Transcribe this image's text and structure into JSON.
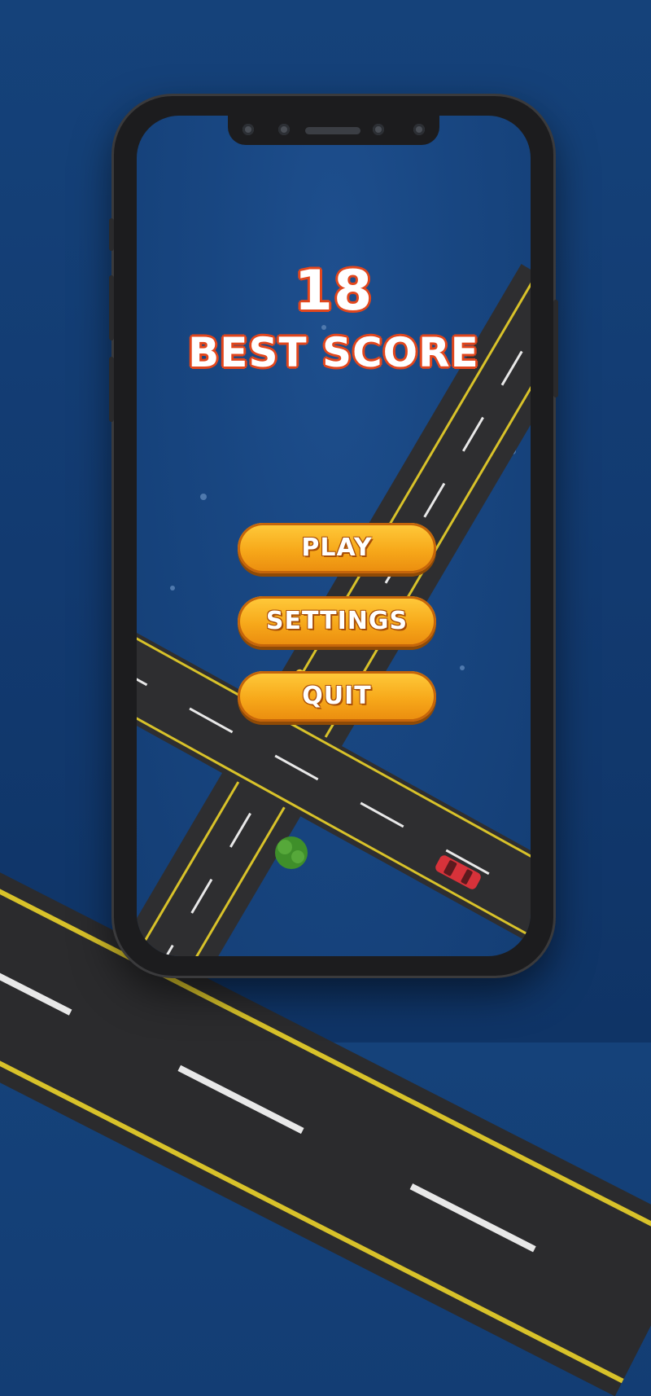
{
  "game": {
    "score": "18",
    "best_score_label": "BEST SCORE"
  },
  "menu": {
    "play_label": "PLAY",
    "settings_label": "SETTINGS",
    "quit_label": "QUIT"
  },
  "colors": {
    "background": "#123a70",
    "road": "#2e2e30",
    "road_edge": "#d8c22a",
    "button_fill": "#f7a81a",
    "score_outline": "#e2461c"
  }
}
